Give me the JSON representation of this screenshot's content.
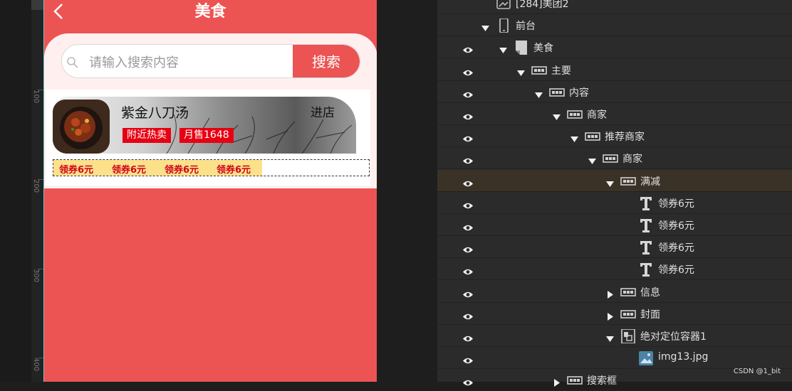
{
  "ruler": {
    "labels": [
      "100",
      "200",
      "300",
      "400"
    ]
  },
  "phone": {
    "title": "美食",
    "search": {
      "placeholder": "请输入搜索内容",
      "button": "搜索"
    },
    "shop": {
      "name": "紫金八刀汤",
      "enter": "进店",
      "tags": [
        "附近热卖",
        "月售1648"
      ],
      "coupons": [
        "领券6元",
        "领券6元",
        "领券6元",
        "领券6元"
      ]
    }
  },
  "tree": {
    "rows": [
      {
        "label": "[284]美团2",
        "icon": "project-icon",
        "indent": 0,
        "eye": false,
        "toggle": "none"
      },
      {
        "label": "前台",
        "icon": "phone-icon",
        "indent": 0,
        "eye": false,
        "toggle": "open"
      },
      {
        "label": "美食",
        "icon": "page-icon",
        "indent": 1,
        "eye": true,
        "toggle": "open"
      },
      {
        "label": "主要",
        "icon": "container-icon",
        "indent": 2,
        "eye": true,
        "toggle": "open"
      },
      {
        "label": "内容",
        "icon": "container-icon",
        "indent": 3,
        "eye": true,
        "toggle": "open"
      },
      {
        "label": "商家",
        "icon": "container-icon",
        "indent": 4,
        "eye": true,
        "toggle": "open"
      },
      {
        "label": "推荐商家",
        "icon": "container-icon",
        "indent": 5,
        "eye": true,
        "toggle": "open"
      },
      {
        "label": "商家",
        "icon": "container-icon",
        "indent": 6,
        "eye": true,
        "toggle": "open"
      },
      {
        "label": "满减",
        "icon": "container-icon",
        "indent": 7,
        "eye": true,
        "toggle": "open",
        "selected": true
      },
      {
        "label": "领券6元",
        "icon": "text-icon",
        "indent": 8,
        "eye": true,
        "toggle": "none"
      },
      {
        "label": "领券6元",
        "icon": "text-icon",
        "indent": 8,
        "eye": true,
        "toggle": "none"
      },
      {
        "label": "领券6元",
        "icon": "text-icon",
        "indent": 8,
        "eye": true,
        "toggle": "none"
      },
      {
        "label": "领券6元",
        "icon": "text-icon",
        "indent": 8,
        "eye": true,
        "toggle": "none"
      },
      {
        "label": "信息",
        "icon": "container-icon",
        "indent": 7,
        "eye": true,
        "toggle": "closed"
      },
      {
        "label": "封面",
        "icon": "container-icon",
        "indent": 7,
        "eye": true,
        "toggle": "closed"
      },
      {
        "label": "绝对定位容器1",
        "icon": "absolute-container-icon",
        "indent": 7,
        "eye": true,
        "toggle": "open"
      },
      {
        "label": "img13.jpg",
        "icon": "image-icon",
        "indent": 8,
        "eye": true,
        "toggle": "none"
      },
      {
        "label": "搜索框",
        "icon": "container-icon",
        "indent": 4,
        "eye": true,
        "toggle": "closed"
      }
    ]
  },
  "watermark": "CSDN @1_bit"
}
